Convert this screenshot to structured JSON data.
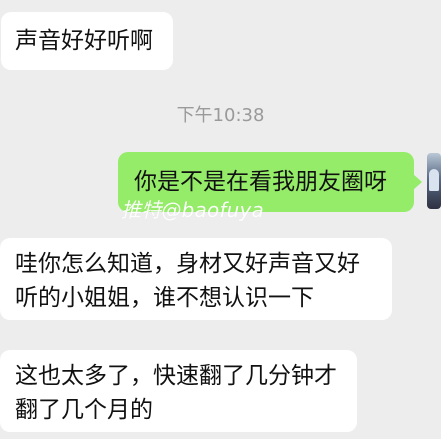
{
  "chat": {
    "messages": {
      "left_1": "声音好好听啊",
      "timestamp": "下午10:38",
      "right_1": "你是不是在看我朋友圈呀",
      "left_2": "哇你怎么知道，身材又好声音又好听的小姐姐，谁不想认识一下",
      "left_3": "这也太多了，快速翻了几分钟才翻了几个月的"
    },
    "watermark": "推特@baofuya"
  },
  "colors": {
    "background": "#ededed",
    "incoming_bubble": "#ffffff",
    "outgoing_bubble": "#95ec69",
    "timestamp": "#9a9a9a",
    "text": "#111111"
  },
  "icons": {
    "avatar": "avatar-image"
  }
}
